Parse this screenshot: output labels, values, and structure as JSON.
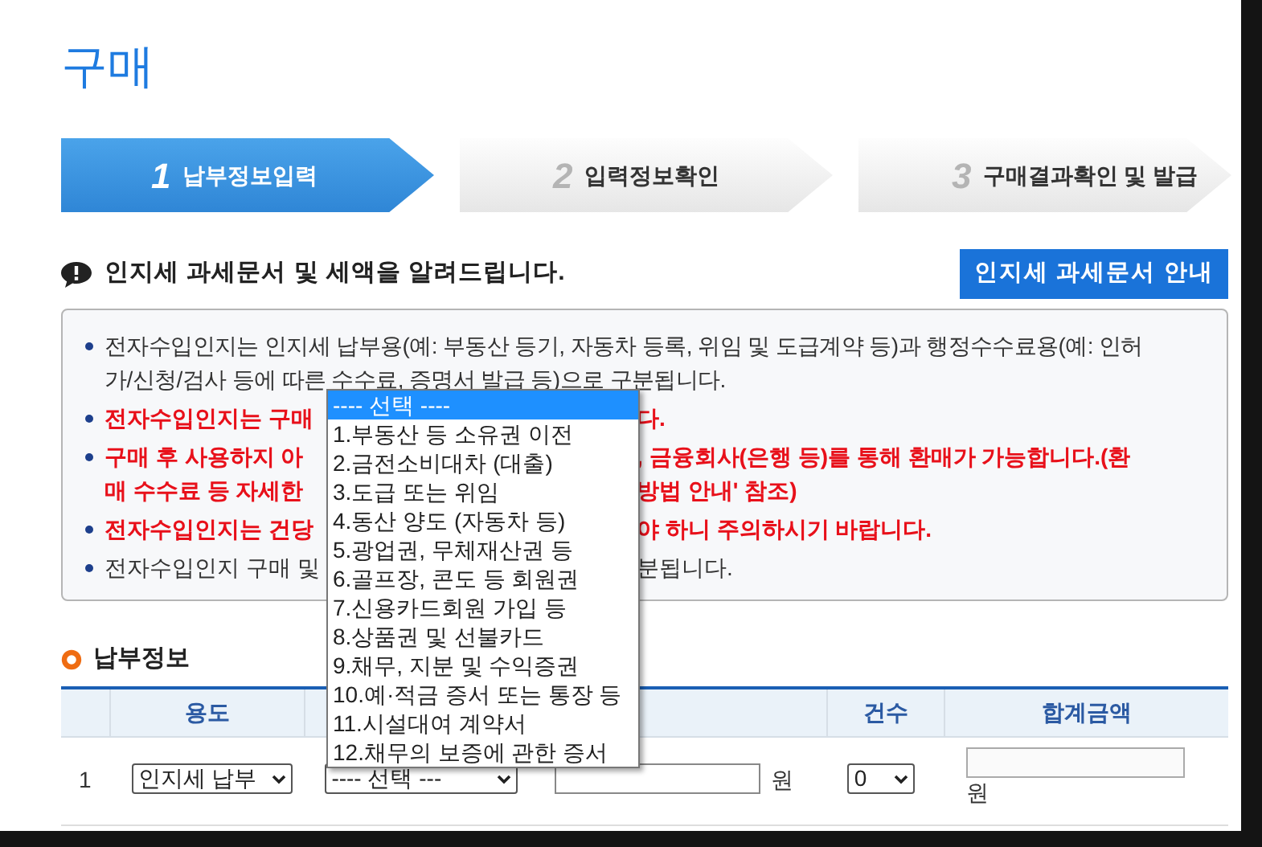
{
  "page_title": "구매",
  "steps": [
    {
      "number": "1",
      "label": "납부정보입력",
      "selected": true
    },
    {
      "number": "2",
      "label": "입력정보확인",
      "selected": false
    },
    {
      "number": "3",
      "label": "구매결과확인 및 발급",
      "selected": false
    }
  ],
  "notice": {
    "heading": "인지세 과세문서 및 세액을 알려드립니다.",
    "button": "인지세 과세문서 안내"
  },
  "info_bullets": [
    {
      "kind": "plain",
      "lines": [
        [
          "전자수입인지는 인지세 납부용(예: 부동산 등기, 자동차 등록, 위임 및 도급계약 등)과 행정수수료용(예: 인허"
        ],
        [
          "가/신청/검사 등에 따른 수수료, 증명서 발급 등)으로 구분됩니다."
        ]
      ]
    },
    {
      "kind": "warning",
      "lines": [
        [
          "전자수입인지는 구매",
          "다."
        ]
      ]
    },
    {
      "kind": "warning",
      "lines": [
        [
          "구매 후 사용하지 아",
          ", 금융회사(은행 등)를 통해 환매가 가능합니다.(환"
        ],
        [
          "매 수수료 등 자세한",
          "방법 안내' 참조)"
        ]
      ]
    },
    {
      "kind": "warning",
      "lines": [
        [
          "전자수입인지는 건당",
          "야 하니 주의하시기 바랍니다."
        ]
      ]
    },
    {
      "kind": "plain",
      "lines": [
        [
          "전자수입인지 구매 및",
          "분됩니다."
        ]
      ]
    }
  ],
  "section_title": "납부정보",
  "table": {
    "header": {
      "usage": "용도",
      "count": "건수",
      "total": "합계금액"
    },
    "row": {
      "number": "1",
      "usage": "인지세 납부",
      "type": "---- 선택 ---",
      "amount_unit": "원",
      "count": "0",
      "total_unit": "원"
    }
  },
  "dropdown": {
    "options": [
      {
        "label": "---- 선택 ----",
        "selected": true
      },
      {
        "label": "1.부동산 등 소유권 이전",
        "selected": false
      },
      {
        "label": "2.금전소비대차 (대출)",
        "selected": false
      },
      {
        "label": "3.도급 또는 위임",
        "selected": false
      },
      {
        "label": "4.동산 양도 (자동차 등)",
        "selected": false
      },
      {
        "label": "5.광업권, 무체재산권 등",
        "selected": false
      },
      {
        "label": "6.골프장, 콘도 등 회원권",
        "selected": false
      },
      {
        "label": "7.신용카드회원 가입 등",
        "selected": false
      },
      {
        "label": "8.상품권 및 선불카드",
        "selected": false
      },
      {
        "label": "9.채무, 지분 및 수익증권",
        "selected": false
      },
      {
        "label": "10.예·적금 증서 또는 통장 등",
        "selected": false
      },
      {
        "label": "11.시설대여 계약서",
        "selected": false
      },
      {
        "label": "12.채무의 보증에 관한 증서",
        "selected": false
      }
    ]
  }
}
